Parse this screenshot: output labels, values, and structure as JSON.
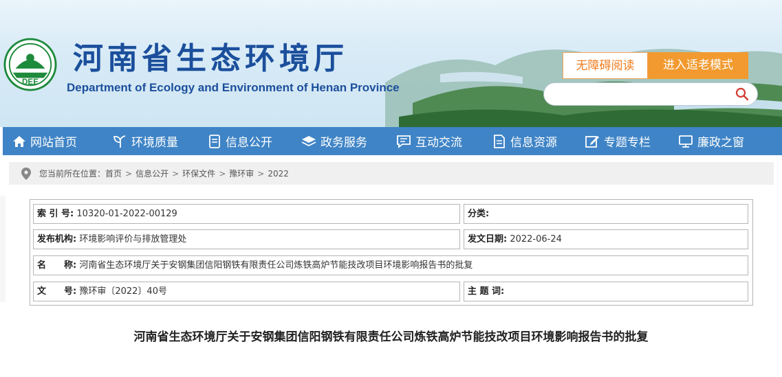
{
  "header": {
    "title": "河南省生态环境厅",
    "subtitle": "Department of Ecology and Environment of Henan Province",
    "logo_text": "DEE",
    "accessibility_label": "无障碍阅读",
    "elder_mode_label": "进入适老模式",
    "search_placeholder": ""
  },
  "nav": {
    "items": [
      {
        "label": "网站首页",
        "icon": "home-icon"
      },
      {
        "label": "环境质量",
        "icon": "leaf-icon"
      },
      {
        "label": "信息公开",
        "icon": "document-icon"
      },
      {
        "label": "政务服务",
        "icon": "layers-icon"
      },
      {
        "label": "互动交流",
        "icon": "chat-icon"
      },
      {
        "label": "信息资源",
        "icon": "file-icon"
      },
      {
        "label": "专题专栏",
        "icon": "edit-icon"
      },
      {
        "label": "廉政之窗",
        "icon": "monitor-icon"
      }
    ]
  },
  "breadcrumb": {
    "prefix": "您当前所在位置：",
    "items": [
      "首页",
      "信息公开",
      "环保文件",
      "豫环审",
      "2022"
    ]
  },
  "info": {
    "index_label": "索 引 号:",
    "index_value": "10320-01-2022-00129",
    "category_label": "分类:",
    "category_value": "",
    "publisher_label": "发布机构:",
    "publisher_value": "环境影响评价与排放管理处",
    "date_label": "发文日期:",
    "date_value": "2022-06-24",
    "name_label": "名　　称:",
    "name_value": "河南省生态环境厅关于安钢集团信阳钢铁有限责任公司炼铁高炉节能技改项目环境影响报告书的批复",
    "docno_label": "文　　号:",
    "docno_value": "豫环审〔2022〕40号",
    "keywords_label": "主 题 词:",
    "keywords_value": ""
  },
  "article": {
    "title": "河南省生态环境厅关于安钢集团信阳钢铁有限责任公司炼铁高炉节能技改项目环境影响报告书的批复"
  },
  "colors": {
    "brand_blue": "#1b4f9c",
    "nav_blue": "#3f84c6",
    "accent_orange": "#f29a2f",
    "logo_green": "#1e8a3c"
  }
}
